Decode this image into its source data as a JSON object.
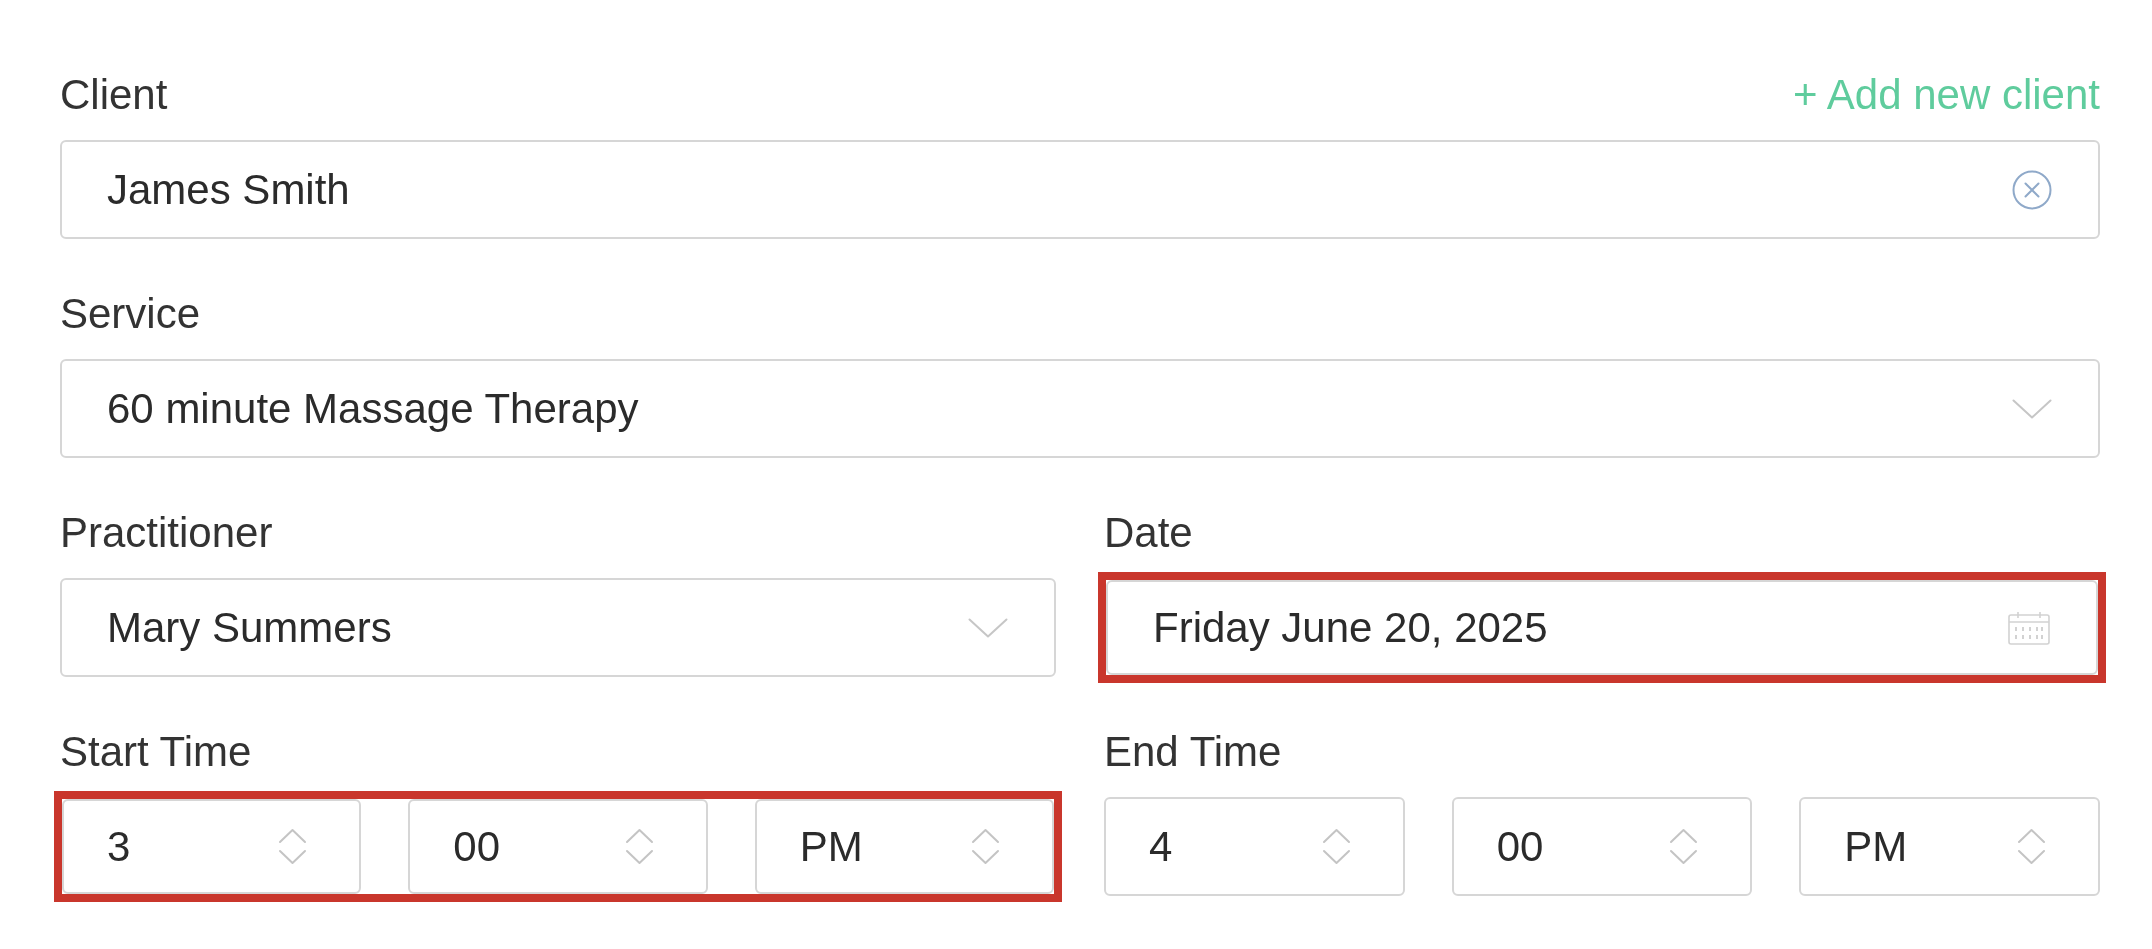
{
  "form": {
    "rows": [
      [
        {
          "kind": "clearable",
          "label": "Client",
          "action": "+ Add new client",
          "value": "James Smith",
          "highlighted": false
        }
      ],
      [
        {
          "kind": "select",
          "label": "Service",
          "value": "60 minute Massage Therapy",
          "highlighted": false
        }
      ],
      [
        {
          "kind": "select",
          "label": "Practitioner",
          "value": "Mary Summers",
          "highlighted": false
        },
        {
          "kind": "date",
          "label": "Date",
          "value": "Friday June 20, 2025",
          "highlighted": true
        }
      ],
      [
        {
          "kind": "time",
          "label": "Start Time",
          "parts": [
            "3",
            "00",
            "PM"
          ],
          "highlighted": true
        },
        {
          "kind": "time",
          "label": "End Time",
          "parts": [
            "4",
            "00",
            "PM"
          ],
          "highlighted": false
        }
      ]
    ]
  }
}
